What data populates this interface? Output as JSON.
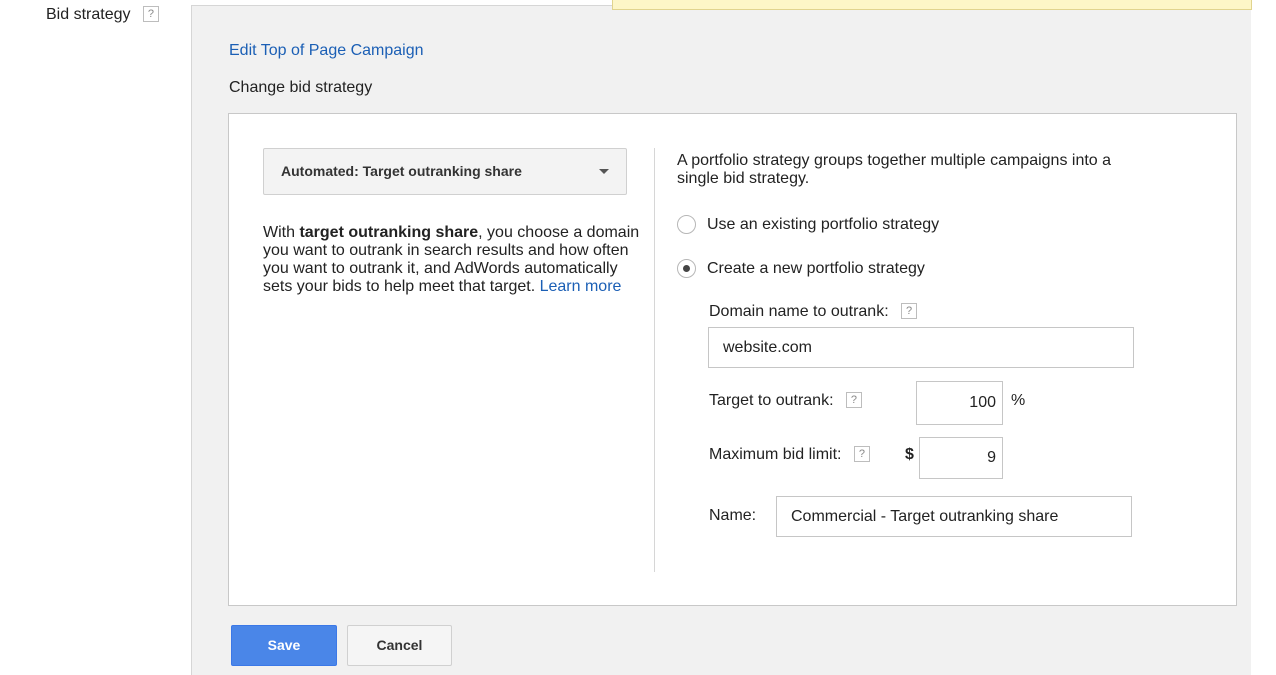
{
  "field": {
    "label": "Bid strategy",
    "help": "?"
  },
  "panel": {
    "edit_link": "Edit Top of Page Campaign",
    "section_title": "Change bid strategy"
  },
  "strategy_dropdown": {
    "selected": "Automated: Target outranking share"
  },
  "description": {
    "prefix": "With ",
    "bold": "target outranking share",
    "body": ", you choose a domain you want to outrank in search results and how often you want to outrank it, and AdWords automatically sets your bids to help meet that target. ",
    "learn_more": "Learn more"
  },
  "portfolio": {
    "intro": "A portfolio strategy groups together multiple campaigns into a single bid strategy.",
    "options": [
      {
        "label": "Use an existing portfolio strategy",
        "checked": false
      },
      {
        "label": "Create a new portfolio strategy",
        "checked": true
      }
    ]
  },
  "form": {
    "domain_label": "Domain name to outrank:",
    "domain_value": "website.com",
    "target_label": "Target to outrank:",
    "target_value": "100",
    "target_unit": "%",
    "maxbid_label": "Maximum bid limit:",
    "maxbid_currency": "$",
    "maxbid_value": "9",
    "name_label": "Name:",
    "name_value": "Commercial - Target outranking share",
    "help": "?"
  },
  "actions": {
    "save": "Save",
    "cancel": "Cancel"
  },
  "colors": {
    "link": "#1b5fb5",
    "primary_button": "#4a86e8"
  }
}
